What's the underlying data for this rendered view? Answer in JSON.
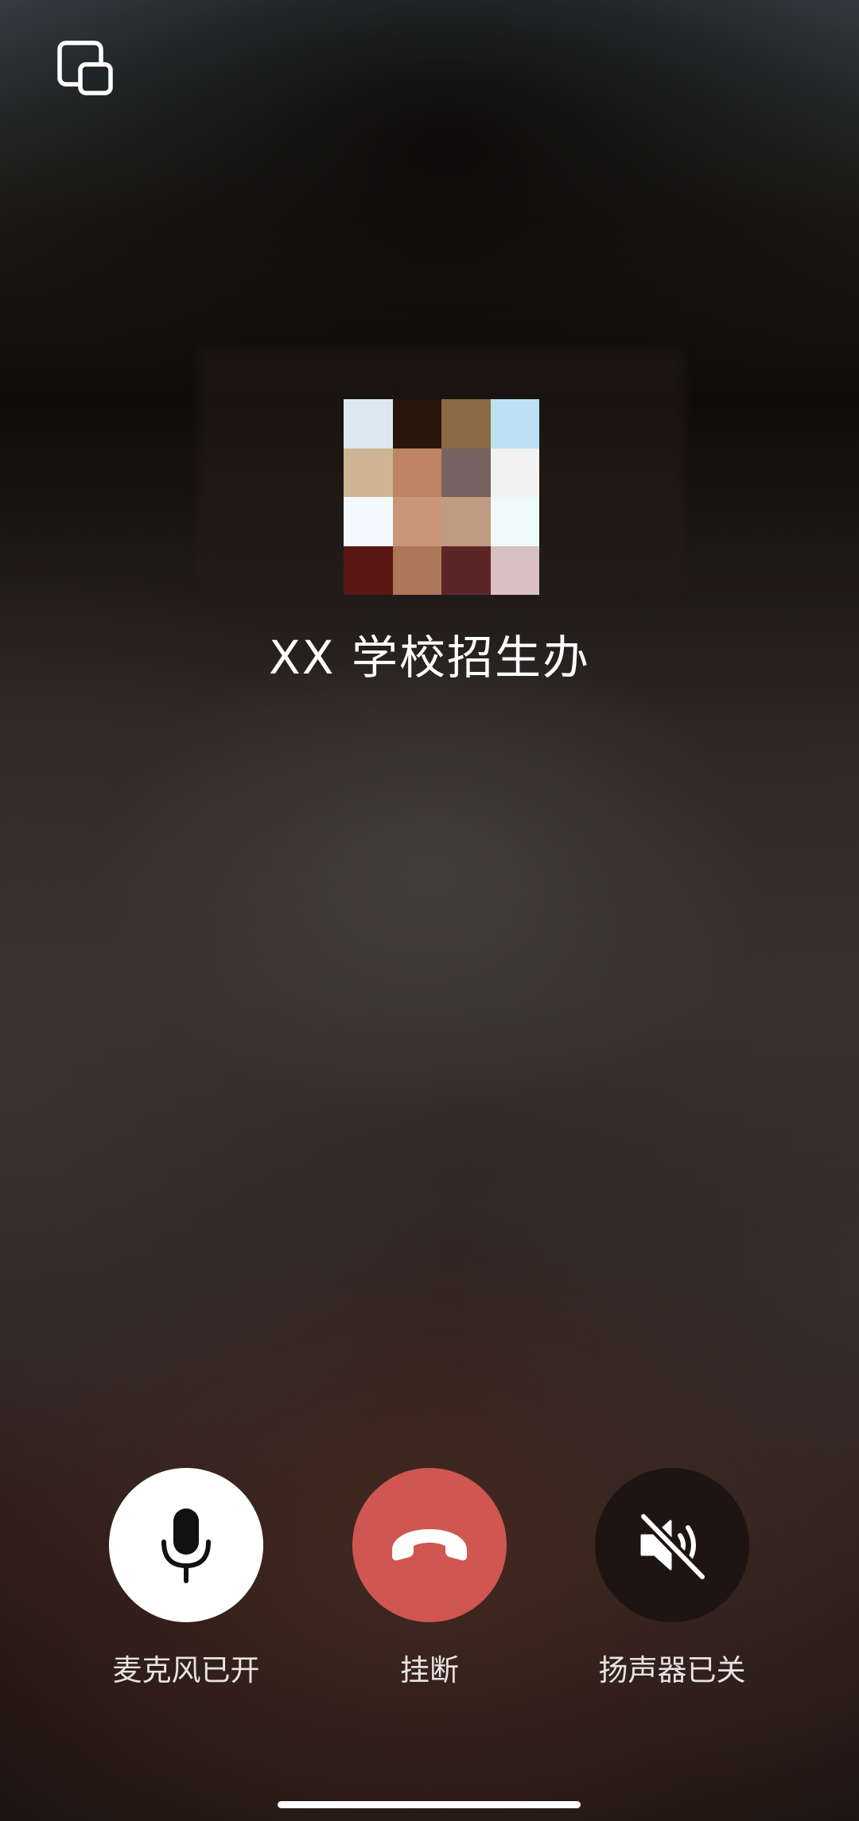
{
  "caller": {
    "name": "XX 学校招生办"
  },
  "avatar": {
    "pixel_colors": [
      "#dde9f2",
      "#2a150b",
      "#8b6b43",
      "#bde0f4",
      "#cdb593",
      "#bd8564",
      "#786362",
      "#f2f2f2",
      "#f3f9fd",
      "#c9957b",
      "#bf9b81",
      "#eefaf9",
      "#5a1612",
      "#ab7756",
      "#5c2628",
      "#d9c0c3"
    ]
  },
  "controls": {
    "microphone": {
      "label": "麦克风已开",
      "icon": "microphone-icon",
      "state": "on"
    },
    "hangup": {
      "label": "挂断",
      "icon": "phone-hangup-icon",
      "color": "#cf5651"
    },
    "speaker": {
      "label": "扬声器已关",
      "icon": "speaker-muted-icon",
      "state": "off"
    }
  },
  "top_bar": {
    "icon": "picture-in-picture-icon"
  }
}
